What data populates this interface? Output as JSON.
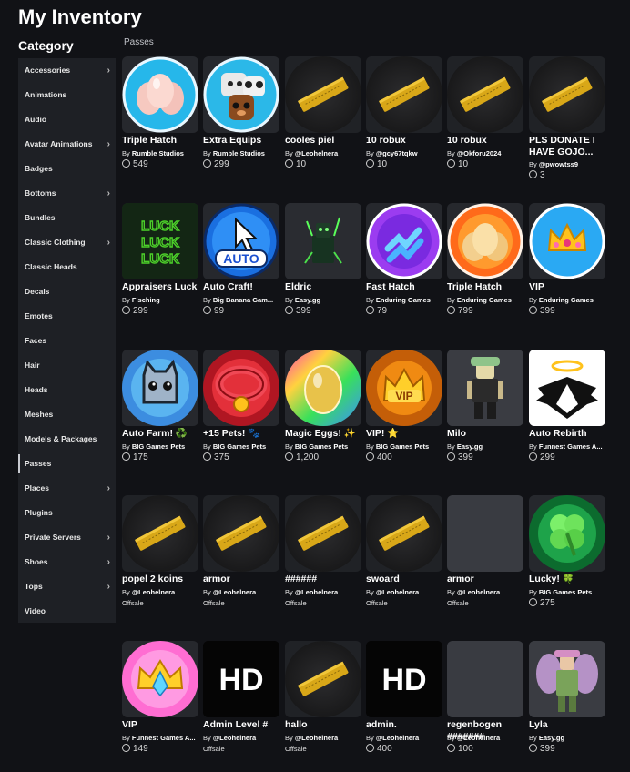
{
  "page": {
    "title": "My Inventory"
  },
  "sidebar": {
    "heading": "Category",
    "items": [
      {
        "label": "Accessories",
        "chevron": true
      },
      {
        "label": "Animations",
        "chevron": false
      },
      {
        "label": "Audio",
        "chevron": false
      },
      {
        "label": "Avatar Animations",
        "chevron": true
      },
      {
        "label": "Badges",
        "chevron": false
      },
      {
        "label": "Bottoms",
        "chevron": true
      },
      {
        "label": "Bundles",
        "chevron": false
      },
      {
        "label": "Classic Clothing",
        "chevron": true
      },
      {
        "label": "Classic Heads",
        "chevron": false
      },
      {
        "label": "Decals",
        "chevron": false
      },
      {
        "label": "Emotes",
        "chevron": false
      },
      {
        "label": "Faces",
        "chevron": false
      },
      {
        "label": "Hair",
        "chevron": false
      },
      {
        "label": "Heads",
        "chevron": false
      },
      {
        "label": "Meshes",
        "chevron": false
      },
      {
        "label": "Models & Packages",
        "chevron": false
      },
      {
        "label": "Passes",
        "chevron": false,
        "active": true
      },
      {
        "label": "Places",
        "chevron": true
      },
      {
        "label": "Plugins",
        "chevron": false
      },
      {
        "label": "Private Servers",
        "chevron": true
      },
      {
        "label": "Shoes",
        "chevron": true
      },
      {
        "label": "Tops",
        "chevron": true
      },
      {
        "label": "Video",
        "chevron": false
      }
    ]
  },
  "section": {
    "title": "Passes"
  },
  "items": [
    {
      "name": "Triple Hatch",
      "by": "By",
      "creator": "Rumble Studios",
      "price": "549",
      "icon": "eggs-icon"
    },
    {
      "name": "Extra Equips",
      "by": "By",
      "creator": "Rumble Studios",
      "price": "299",
      "icon": "pets-icon"
    },
    {
      "name": "cooles piel",
      "by": "By",
      "creator": "@Leohelnera",
      "price": "10",
      "icon": "ticket-icon"
    },
    {
      "name": "10 robux",
      "by": "By",
      "creator": "@gcy67tqkw",
      "price": "10",
      "icon": "ticket-icon"
    },
    {
      "name": "10 robux",
      "by": "By",
      "creator": "@Okforu2024",
      "price": "10",
      "icon": "ticket-icon"
    },
    {
      "name": "PLS DONATE I HAVE GOJO...",
      "by": "By",
      "creator": "@pwowtss9",
      "price": "3",
      "icon": "ticket-icon"
    },
    {
      "name": "Appraisers Luck",
      "by": "By",
      "creator": "Fisching",
      "price": "299",
      "icon": "luck-icon"
    },
    {
      "name": "Auto Craft!",
      "by": "By",
      "creator": "Big Banana Gam...",
      "price": "99",
      "icon": "auto-icon"
    },
    {
      "name": "Eldric",
      "by": "By",
      "creator": "Easy.gg",
      "price": "399",
      "icon": "eldric-icon"
    },
    {
      "name": "Fast Hatch",
      "by": "By",
      "creator": "Enduring Games",
      "price": "79",
      "icon": "fast-hatch-icon"
    },
    {
      "name": "Triple Hatch",
      "by": "By",
      "creator": "Enduring Games",
      "price": "799",
      "icon": "eggs-orange-icon"
    },
    {
      "name": "VIP",
      "by": "By",
      "creator": "Enduring Games",
      "price": "399",
      "icon": "crown-icon"
    },
    {
      "name": "Auto Farm! ♻️",
      "by": "By",
      "creator": "BIG Games Pets",
      "price": "175",
      "icon": "cat-icon"
    },
    {
      "name": "+15 Pets! 🐾",
      "by": "By",
      "creator": "BIG Games Pets",
      "price": "375",
      "icon": "collar-icon"
    },
    {
      "name": "Magic Eggs! ✨",
      "by": "By",
      "creator": "BIG Games Pets",
      "price": "1,200",
      "icon": "magic-egg-icon"
    },
    {
      "name": "VIP! ⭐",
      "by": "By",
      "creator": "BIG Games Pets",
      "price": "400",
      "icon": "vip-crown-icon"
    },
    {
      "name": "Milo",
      "by": "By",
      "creator": "Easy.gg",
      "price": "399",
      "icon": "avatar-icon"
    },
    {
      "name": "Auto Rebirth",
      "by": "By",
      "creator": "Funnest Games A...",
      "price": "299",
      "icon": "wings-icon"
    },
    {
      "name": "popel 2 koins",
      "by": "By",
      "creator": "@Leohelnera",
      "offsale": "Offsale",
      "icon": "ticket-icon"
    },
    {
      "name": "armor",
      "by": "By",
      "creator": "@Leohelnera",
      "offsale": "Offsale",
      "icon": "ticket-icon"
    },
    {
      "name": "######",
      "by": "By",
      "creator": "@Leohelnera",
      "offsale": "Offsale",
      "icon": "ticket-icon"
    },
    {
      "name": "swoard",
      "by": "By",
      "creator": "@Leohelnera",
      "offsale": "Offsale",
      "icon": "ticket-icon"
    },
    {
      "name": "armor",
      "by": "By",
      "creator": "@Leohelnera",
      "offsale": "Offsale",
      "icon": "blank-thumbnail"
    },
    {
      "name": "Lucky! 🍀",
      "by": "By",
      "creator": "BIG Games Pets",
      "price": "275",
      "icon": "clover-icon"
    },
    {
      "name": "VIP",
      "by": "By",
      "creator": "Funnest Games A...",
      "price": "149",
      "icon": "gem-crown-icon"
    },
    {
      "name": "Admin Level #",
      "by": "By",
      "creator": "@Leohelnera",
      "offsale": "Offsale",
      "icon": "hd-icon"
    },
    {
      "name": "hallo",
      "by": "By",
      "creator": "@Leohelnera",
      "offsale": "Offsale",
      "icon": "ticket-icon"
    },
    {
      "name": "admin.",
      "by": "By",
      "creator": "@Leohelnera",
      "price": "400",
      "icon": "hd-icon"
    },
    {
      "name": "regenbogen #######",
      "by": "By",
      "creator": "@Leohelnera",
      "price": "100",
      "icon": "blank-thumbnail"
    },
    {
      "name": "Lyla",
      "by": "By",
      "creator": "Easy.gg",
      "price": "399",
      "icon": "fairy-icon"
    }
  ]
}
